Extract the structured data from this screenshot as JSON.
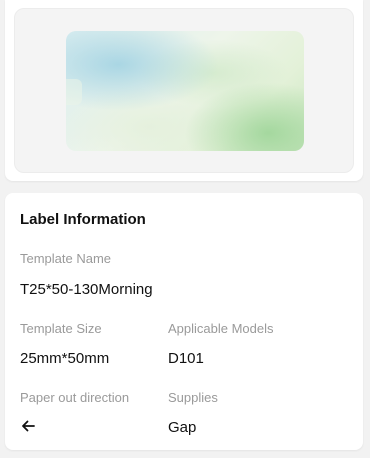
{
  "preview": {
    "image_icon": "watercolor-label-preview"
  },
  "info": {
    "title": "Label Information",
    "template_name_label": "Template Name",
    "template_name_value": "T25*50-130Morning",
    "template_size_label": "Template Size",
    "template_size_value": "25mm*50mm",
    "models_label": "Applicable Models",
    "models_value": "D101",
    "direction_label": "Paper out direction",
    "direction_icon": "arrow-left-icon",
    "supplies_label": "Supplies",
    "supplies_value": "Gap"
  }
}
